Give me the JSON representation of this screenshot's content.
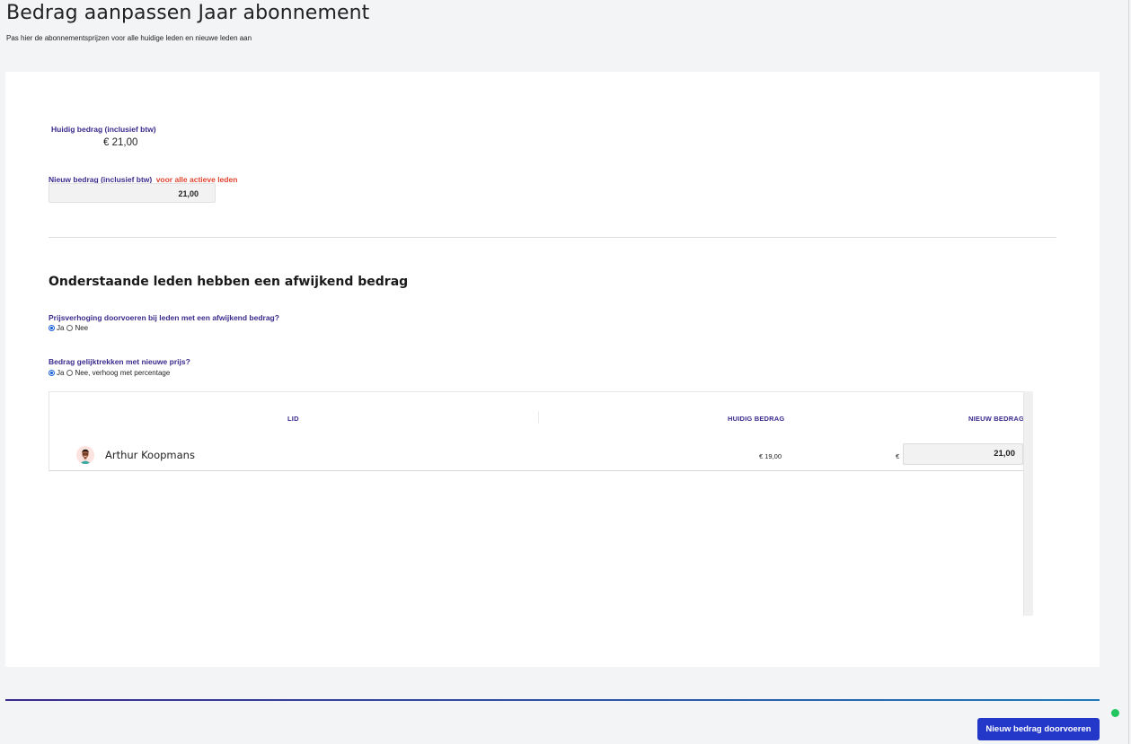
{
  "header": {
    "title": "Bedrag aanpassen Jaar abonnement",
    "subtitle": "Pas hier de abonnementsprijzen voor alle huidige leden en nieuwe leden aan"
  },
  "current": {
    "label": "Huidig bedrag (inclusief btw)",
    "value": "€ 21,00"
  },
  "new_amount": {
    "label": "Nieuw bedrag (inclusief btw)",
    "label_highlight": "voor alle actieve leden",
    "value": "21,00"
  },
  "deviating": {
    "title": "Onderstaande leden hebben een afwijkend bedrag",
    "question1": {
      "label": "Prijsverhoging doorvoeren bij leden met een afwijkend bedrag?",
      "options": [
        "Ja",
        "Nee"
      ],
      "selected": "Ja"
    },
    "question2": {
      "label": "Bedrag gelijktrekken met nieuwe prijs?",
      "options": [
        "Ja",
        "Nee, verhoog met percentage"
      ],
      "selected": "Ja"
    }
  },
  "table": {
    "columns": [
      "LID",
      "HUIDIG BEDRAG",
      "NIEUW BEDRAG"
    ],
    "rows": [
      {
        "name": "Arthur Koopmans",
        "current_amount": "€ 19,00",
        "currency": "€",
        "new_amount": "21,00"
      }
    ]
  },
  "footer": {
    "submit_label": "Nieuw bedrag doorvoeren"
  },
  "colors": {
    "accent_purple": "#3b2a8c",
    "highlight_red": "#e0432e",
    "button_blue": "#2338c8",
    "status_green": "#22c55e"
  }
}
